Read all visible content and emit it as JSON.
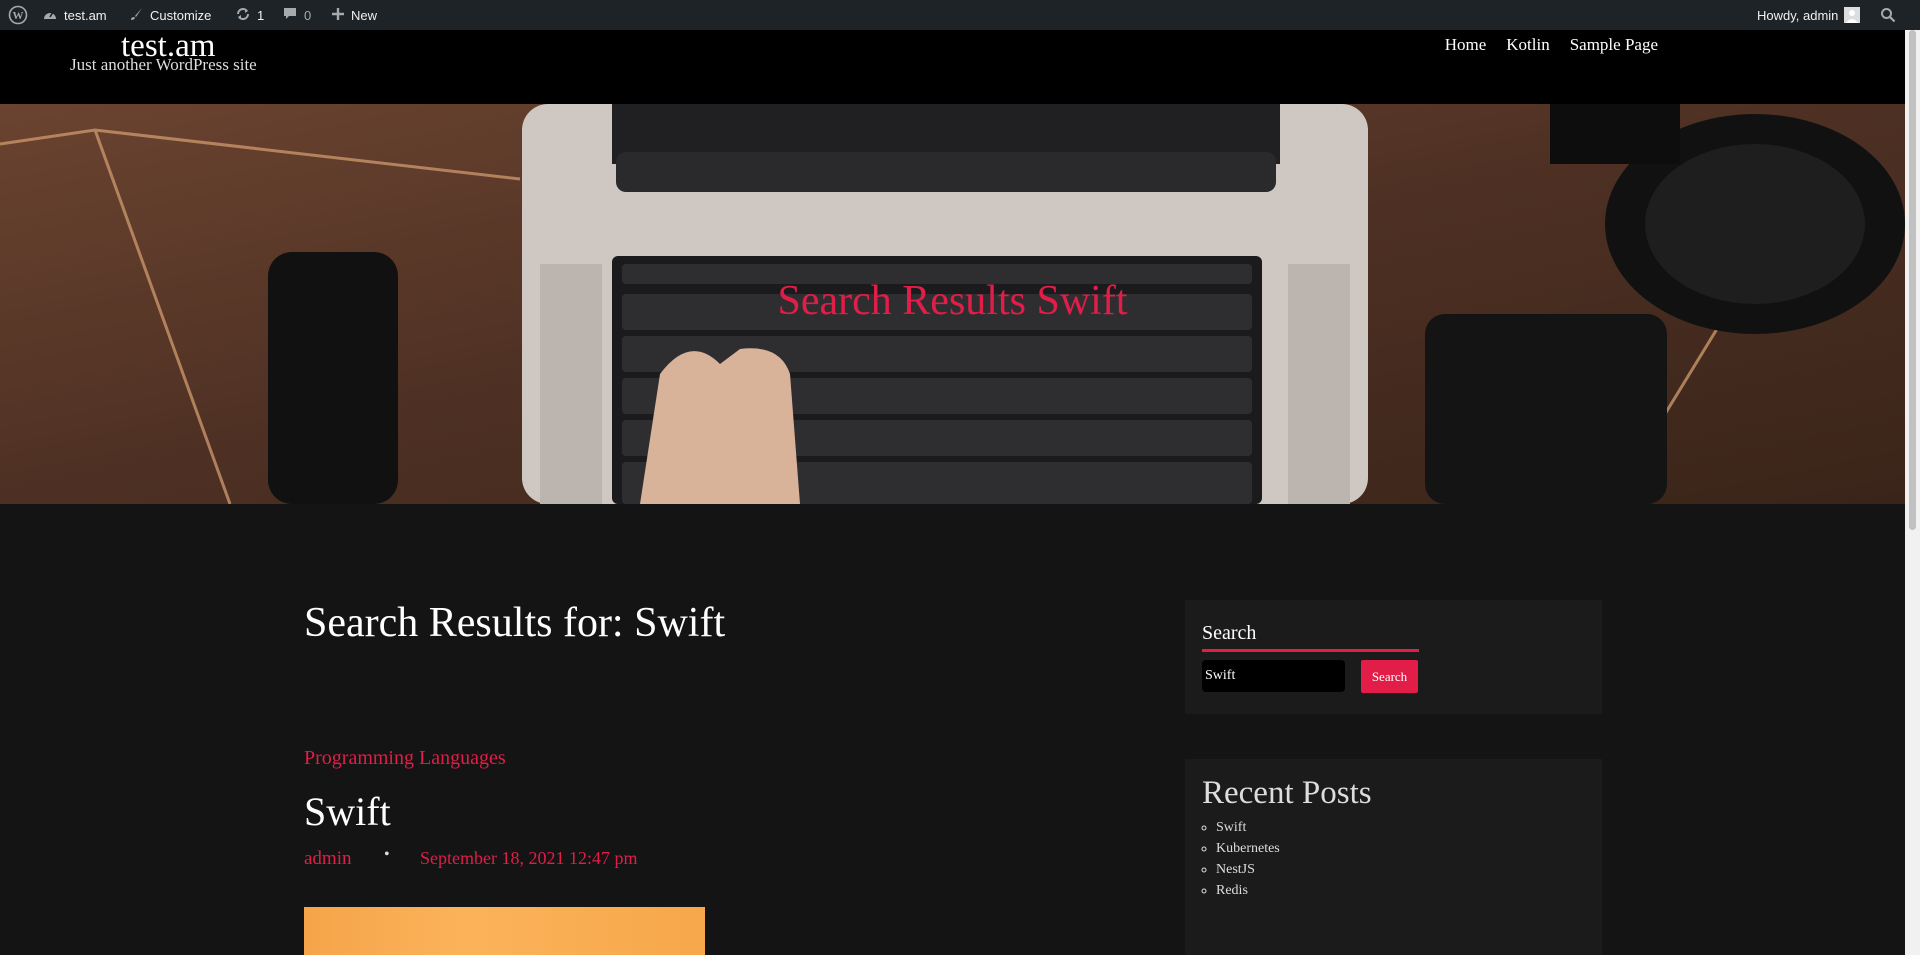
{
  "adminbar": {
    "site": "test.am",
    "customize": "Customize",
    "updates_count": "1",
    "comments_count": "0",
    "new_label": "New",
    "greeting": "Howdy, admin"
  },
  "header": {
    "site_title": "test.am",
    "tagline": "Just another WordPress site",
    "nav": [
      "Home",
      "Kotlin",
      "Sample Page"
    ]
  },
  "hero": {
    "title": "Search Results Swift"
  },
  "main": {
    "page_title": "Search Results for: Swift",
    "post": {
      "category": "Programming Languages",
      "title": "Swift",
      "author": "admin",
      "bullet": "•",
      "date": "September 18, 2021 12:47 pm"
    }
  },
  "sidebar": {
    "search": {
      "title": "Search",
      "value": "Swift",
      "button": "Search"
    },
    "recent": {
      "title": "Recent Posts",
      "items": [
        "Swift",
        "Kubernetes",
        "NestJS",
        "Redis"
      ]
    }
  },
  "colors": {
    "accent": "#e11d48",
    "adminbar": "#1d2327",
    "background": "#141414"
  }
}
